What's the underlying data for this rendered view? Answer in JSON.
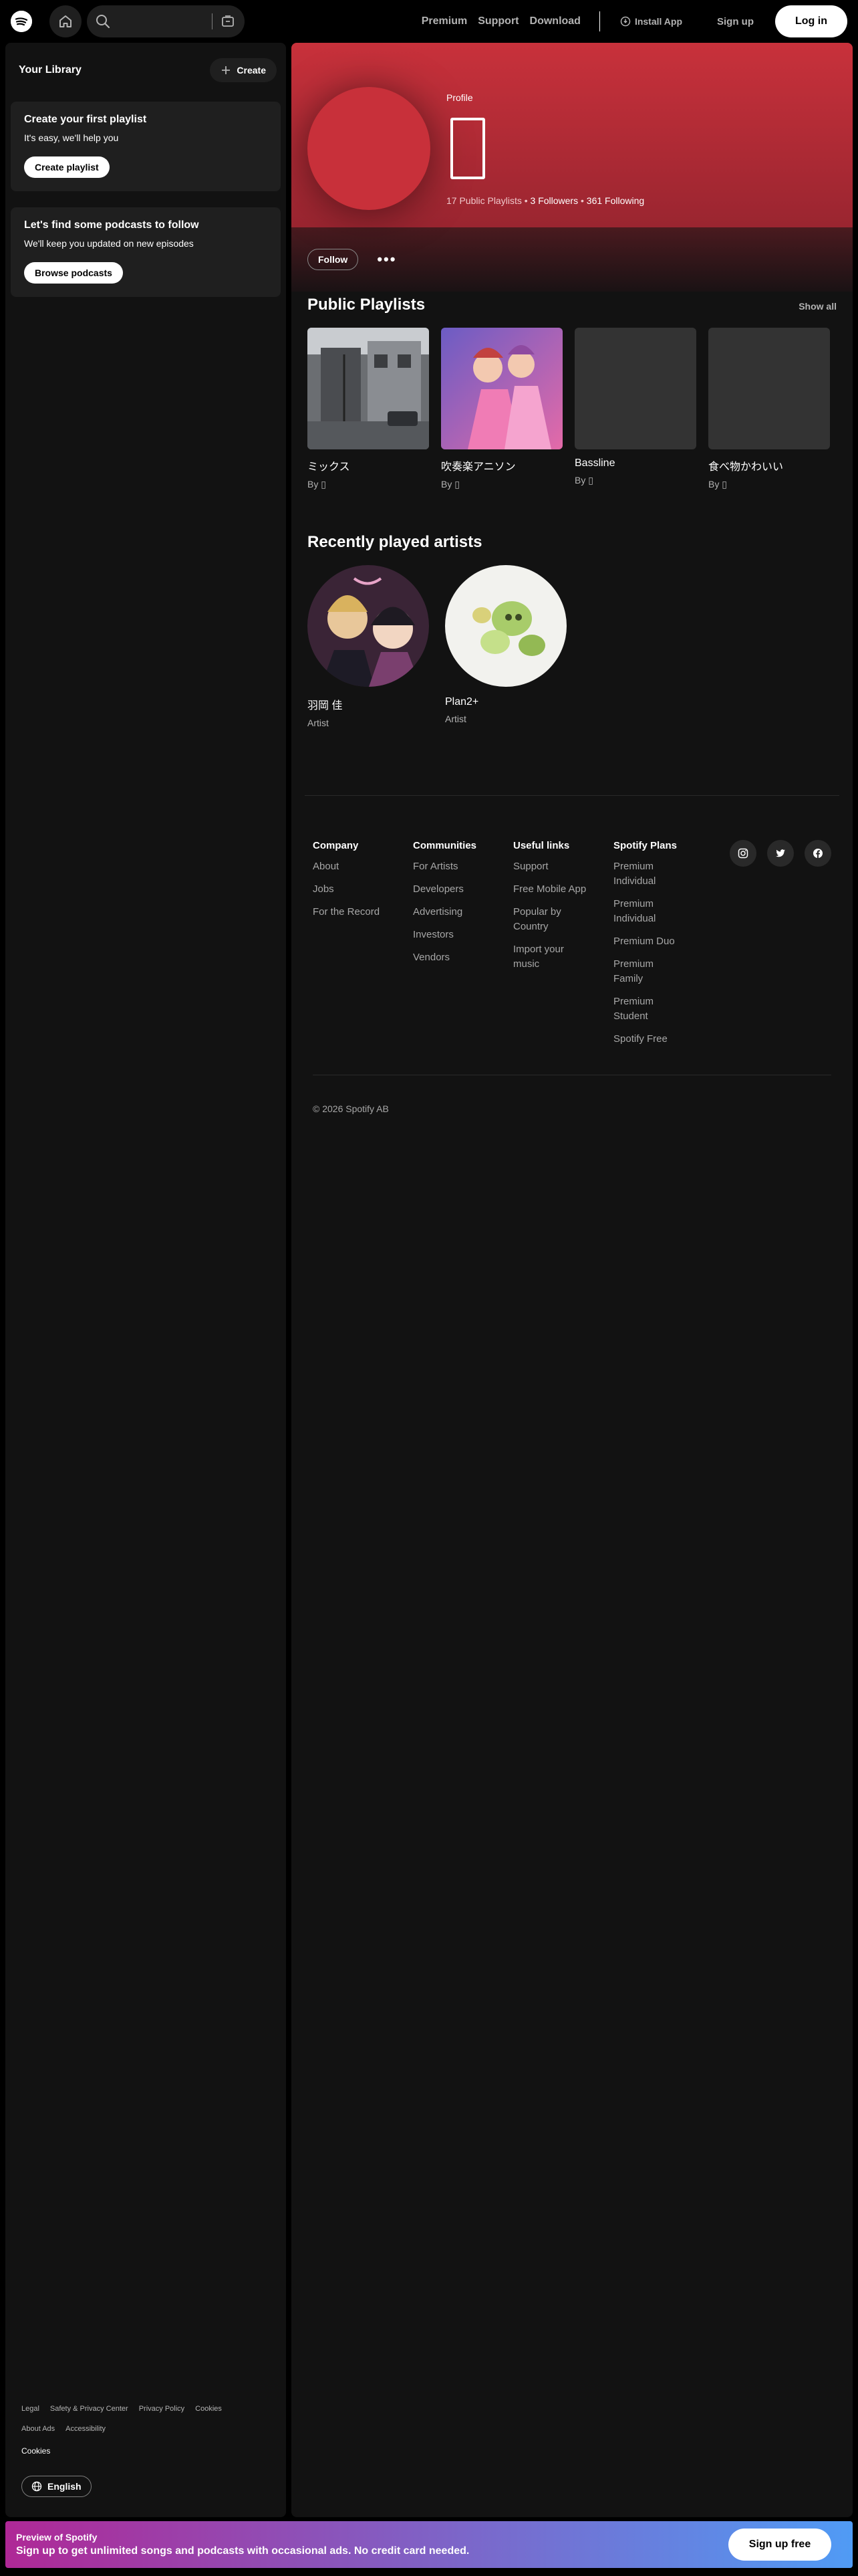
{
  "topbar": {
    "search_placeholder": "",
    "nav_links": [
      "Premium",
      "Support",
      "Download"
    ],
    "install_label": "Install App",
    "signup_label": "Sign up",
    "login_label": "Log in"
  },
  "sidebar": {
    "title": "Your Library",
    "create_label": "Create",
    "playlist_card": {
      "title": "Create your first playlist",
      "text": "It's easy, we'll help you",
      "button": "Create playlist"
    },
    "podcast_card": {
      "title": "Let's find some podcasts to follow",
      "text": "We'll keep you updated on new episodes",
      "button": "Browse podcasts"
    },
    "legal_links": [
      "Legal",
      "Safety & Privacy Center",
      "Privacy Policy",
      "Cookies",
      "About Ads",
      "Accessibility"
    ],
    "cookies": "Cookies",
    "language": "English"
  },
  "profile": {
    "kind": "Profile",
    "playlists": "17 Public Playlists",
    "followers": "3 Followers",
    "following": "361 Following",
    "follow_label": "Follow",
    "more_label": "•••",
    "hero_color": "#c8313b"
  },
  "public_playlists": {
    "title": "Public Playlists",
    "show_all": "Show all",
    "items": [
      {
        "name": "ミックス",
        "by": "By ▯"
      },
      {
        "name": "吹奏楽アニソン",
        "by": "By ▯"
      },
      {
        "name": "Bassline",
        "by": "By ▯"
      },
      {
        "name": "食べ物かわいい",
        "by": "By ▯"
      }
    ]
  },
  "recent_artists": {
    "title": "Recently played artists",
    "items": [
      {
        "name": "羽岡 佳",
        "kind": "Artist"
      },
      {
        "name": "Plan2+",
        "kind": "Artist"
      }
    ]
  },
  "footer": {
    "columns": [
      {
        "title": "Company",
        "links": [
          "About",
          "Jobs",
          "For the Record"
        ]
      },
      {
        "title": "Communities",
        "links": [
          "For Artists",
          "Developers",
          "Advertising",
          "Investors",
          "Vendors"
        ]
      },
      {
        "title": "Useful links",
        "links": [
          "Support",
          "Free Mobile App",
          "Popular by Country",
          "Import your music"
        ]
      },
      {
        "title": "Spotify Plans",
        "links": [
          "Premium Individual",
          "Premium Individual",
          "Premium Duo",
          "Premium Family",
          "Premium Student",
          "Spotify Free"
        ]
      }
    ],
    "copyright": "© 2026 Spotify AB"
  },
  "banner": {
    "title": "Preview of Spotify",
    "text": "Sign up to get unlimited songs and podcasts with occasional ads. No credit card needed.",
    "button": "Sign up free"
  }
}
